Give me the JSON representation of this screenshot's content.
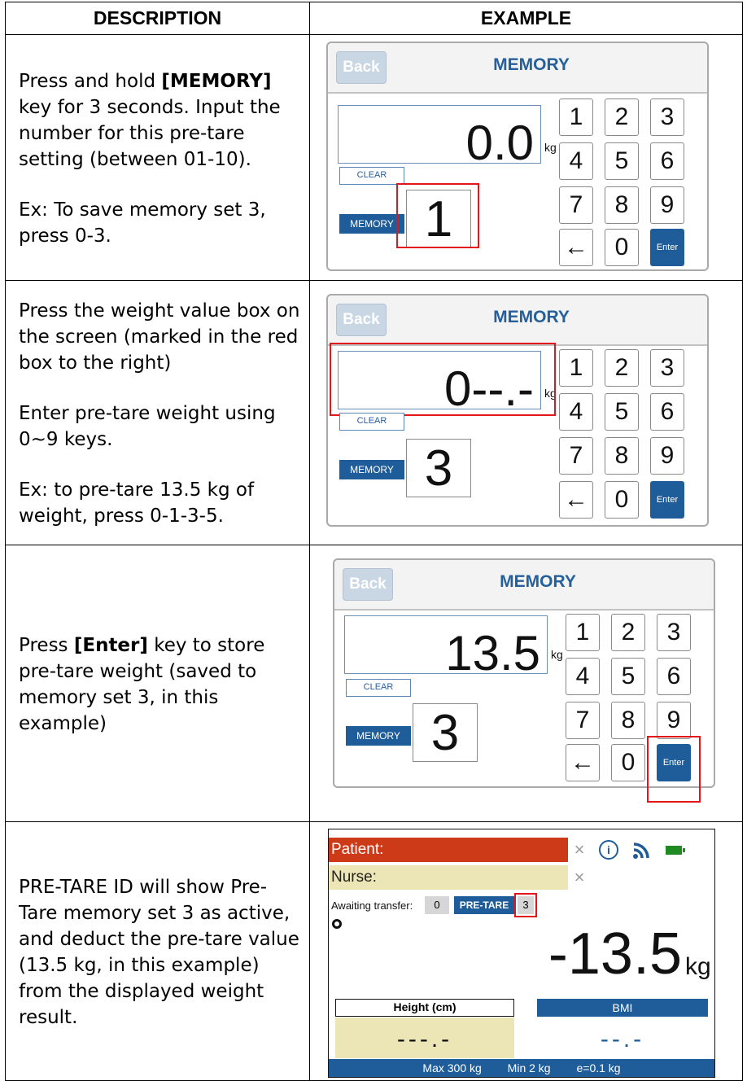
{
  "table": {
    "headers": [
      "DESCRIPTION",
      "EXAMPLE"
    ]
  },
  "rows": [
    {
      "desc": {
        "p1_pre": "Press and hold ",
        "p1_bold": "[MEMORY]",
        "p1_post": " key for 3 seconds. Input the number for this pre-tare setting (between 01-10).",
        "p2": "Ex: To save memory set 3, press 0-3."
      },
      "device": {
        "back": "Back",
        "title": "MEMORY",
        "weight": "0.0",
        "unit": "kg",
        "clear": "CLEAR",
        "memory_label": "MEMORY",
        "memory_value": "1"
      }
    },
    {
      "desc": {
        "p1": "Press the weight value box on the screen (marked in the red box to the right)",
        "p2": "Enter pre-tare weight using 0~9 keys.",
        "p3": "Ex: to pre-tare 13.5 kg of weight, press 0-1-3-5."
      },
      "device": {
        "back": "Back",
        "title": "MEMORY",
        "weight": "0--.-",
        "unit": "kg",
        "clear": "CLEAR",
        "memory_label": "MEMORY",
        "memory_value": "3"
      }
    },
    {
      "desc": {
        "p1_pre": "Press ",
        "p1_bold": "[Enter]",
        "p1_post": " key to store pre-tare weight (saved to memory set 3, in this example)"
      },
      "device": {
        "back": "Back",
        "title": "MEMORY",
        "weight": "13.5",
        "unit": "kg",
        "clear": "CLEAR",
        "memory_label": "MEMORY",
        "memory_value": "3"
      }
    },
    {
      "desc": {
        "p1": "PRE-TARE ID will show Pre-Tare memory set 3 as active, and deduct the pre-tare value (13.5 kg, in this example) from the displayed weight result."
      },
      "screen": {
        "patient": "Patient:",
        "nurse": "Nurse:",
        "clear_x": "×",
        "info": "i",
        "awaiting_label": "Awaiting transfer:",
        "awaiting_value": "0",
        "pretare_label": "PRE-TARE",
        "pretare_value": "3",
        "weight": "-13.5",
        "unit": "kg",
        "height_label": "Height (cm)",
        "height_value": "---.-",
        "bmi_label": "BMI",
        "bmi_value": "--.-",
        "footer_max": "Max 300 kg",
        "footer_min": "Min 2 kg",
        "footer_e": "e=0.1 kg"
      }
    }
  ],
  "keypad": {
    "keys": [
      "1",
      "2",
      "3",
      "4",
      "5",
      "6",
      "7",
      "8",
      "9",
      "←",
      "0",
      "Enter"
    ]
  },
  "colors": {
    "accent_blue": "#1f5d9a",
    "highlight_red": "#e0161b",
    "patient_bar": "#cc3a18",
    "nurse_bar": "#ece5b6"
  }
}
